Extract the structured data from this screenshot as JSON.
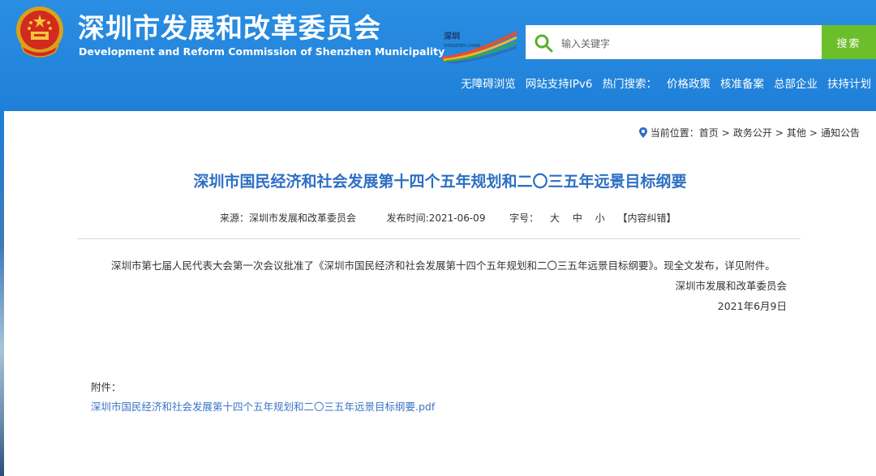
{
  "header": {
    "title_cn": "深圳市发展和改革委员会",
    "title_en": "Development and Reform Commission of Shenzhen Municipality",
    "logo_text": "深圳 SHENZHEN CHINA"
  },
  "search": {
    "placeholder": "输入关键字",
    "button_label": "搜索"
  },
  "topnav": {
    "items": [
      "无障碍浏览",
      "网站支持IPv6",
      "热门搜索：",
      "价格政策",
      "核准备案",
      "总部企业",
      "扶持计划"
    ]
  },
  "breadcrumb": {
    "label": "当前位置：",
    "items": [
      "首页",
      "政务公开",
      "其他",
      "通知公告"
    ],
    "separator": ">"
  },
  "article": {
    "title": "深圳市国民经济和社会发展第十四个五年规划和二〇三五年远景目标纲要",
    "source": "来源：深圳市发展和改革委员会",
    "publish_time": "发布时间:2021-06-09",
    "font_size_label": "字号：",
    "font_sizes": [
      "大",
      "中",
      "小"
    ],
    "error_report": "【内容纠错】",
    "body": "深圳市第七届人民代表大会第一次会议批准了《深圳市国民经济和社会发展第十四个五年规划和二〇三五年远景目标纲要》。现全文发布，详见附件。",
    "signature_org": "深圳市发展和改革委员会",
    "signature_date": "2021年6月9日",
    "attachment_label": "附件：",
    "attachment_link": "深圳市国民经济和社会发展第十四个五年规划和二〇三五年远景目标纲要.pdf"
  },
  "colors": {
    "header_blue": "#2a8ee2",
    "search_green": "#6cbf2a",
    "title_blue": "#2d6fc4",
    "link_blue": "#3a74c7"
  }
}
